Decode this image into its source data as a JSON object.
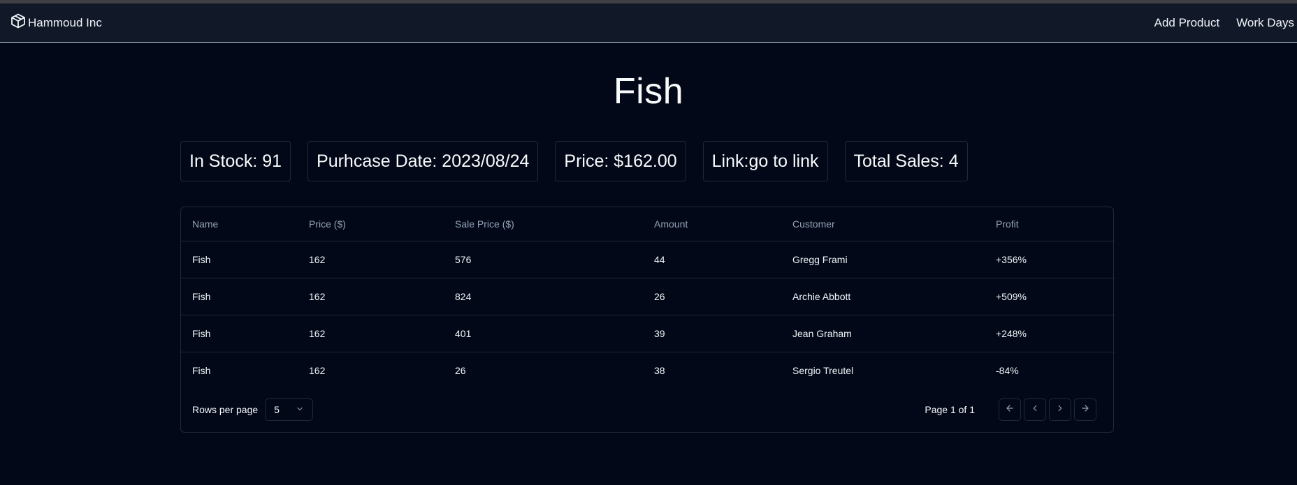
{
  "nav": {
    "brand": "Hammoud Inc",
    "links": [
      "Add Product",
      "Work Days"
    ]
  },
  "product": {
    "title": "Fish",
    "stats": [
      "In Stock: 91",
      "Purhcase Date: 2023/08/24",
      "Price: $162.00",
      "Link:go to link",
      "Total Sales: 4"
    ]
  },
  "table": {
    "headers": [
      "Name",
      "Price ($)",
      "Sale Price ($)",
      "Amount",
      "Customer",
      "Profit"
    ],
    "rows": [
      [
        "Fish",
        "162",
        "576",
        "44",
        "Gregg Frami",
        "+356%"
      ],
      [
        "Fish",
        "162",
        "824",
        "26",
        "Archie Abbott",
        "+509%"
      ],
      [
        "Fish",
        "162",
        "401",
        "39",
        "Jean Graham",
        "+248%"
      ],
      [
        "Fish",
        "162",
        "26",
        "38",
        "Sergio Treutel",
        "-84%"
      ]
    ]
  },
  "pagination": {
    "rows_per_page_label": "Rows per page",
    "rows_per_page_value": "5",
    "page_info": "Page 1 of 1"
  },
  "icons": {
    "brand": "package-icon",
    "select": "chevron-down-icon",
    "first": "arrow-left-icon",
    "prev": "chevron-left-icon",
    "next": "chevron-right-icon",
    "last": "arrow-right-icon"
  }
}
